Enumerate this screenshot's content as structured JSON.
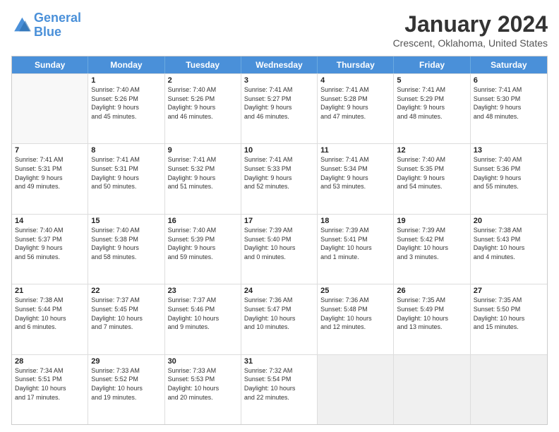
{
  "logo": {
    "text_general": "General",
    "text_blue": "Blue"
  },
  "title": "January 2024",
  "location": "Crescent, Oklahoma, United States",
  "days_header": [
    "Sunday",
    "Monday",
    "Tuesday",
    "Wednesday",
    "Thursday",
    "Friday",
    "Saturday"
  ],
  "weeks": [
    [
      {
        "day": "",
        "sunrise": "",
        "sunset": "",
        "daylight": "",
        "empty": true
      },
      {
        "day": "1",
        "sunrise": "Sunrise: 7:40 AM",
        "sunset": "Sunset: 5:26 PM",
        "daylight": "Daylight: 9 hours and 45 minutes."
      },
      {
        "day": "2",
        "sunrise": "Sunrise: 7:40 AM",
        "sunset": "Sunset: 5:26 PM",
        "daylight": "Daylight: 9 hours and 46 minutes."
      },
      {
        "day": "3",
        "sunrise": "Sunrise: 7:41 AM",
        "sunset": "Sunset: 5:27 PM",
        "daylight": "Daylight: 9 hours and 46 minutes."
      },
      {
        "day": "4",
        "sunrise": "Sunrise: 7:41 AM",
        "sunset": "Sunset: 5:28 PM",
        "daylight": "Daylight: 9 hours and 47 minutes."
      },
      {
        "day": "5",
        "sunrise": "Sunrise: 7:41 AM",
        "sunset": "Sunset: 5:29 PM",
        "daylight": "Daylight: 9 hours and 48 minutes."
      },
      {
        "day": "6",
        "sunrise": "Sunrise: 7:41 AM",
        "sunset": "Sunset: 5:30 PM",
        "daylight": "Daylight: 9 hours and 48 minutes."
      }
    ],
    [
      {
        "day": "7",
        "sunrise": "Sunrise: 7:41 AM",
        "sunset": "Sunset: 5:31 PM",
        "daylight": "Daylight: 9 hours and 49 minutes."
      },
      {
        "day": "8",
        "sunrise": "Sunrise: 7:41 AM",
        "sunset": "Sunset: 5:31 PM",
        "daylight": "Daylight: 9 hours and 50 minutes."
      },
      {
        "day": "9",
        "sunrise": "Sunrise: 7:41 AM",
        "sunset": "Sunset: 5:32 PM",
        "daylight": "Daylight: 9 hours and 51 minutes."
      },
      {
        "day": "10",
        "sunrise": "Sunrise: 7:41 AM",
        "sunset": "Sunset: 5:33 PM",
        "daylight": "Daylight: 9 hours and 52 minutes."
      },
      {
        "day": "11",
        "sunrise": "Sunrise: 7:41 AM",
        "sunset": "Sunset: 5:34 PM",
        "daylight": "Daylight: 9 hours and 53 minutes."
      },
      {
        "day": "12",
        "sunrise": "Sunrise: 7:40 AM",
        "sunset": "Sunset: 5:35 PM",
        "daylight": "Daylight: 9 hours and 54 minutes."
      },
      {
        "day": "13",
        "sunrise": "Sunrise: 7:40 AM",
        "sunset": "Sunset: 5:36 PM",
        "daylight": "Daylight: 9 hours and 55 minutes."
      }
    ],
    [
      {
        "day": "14",
        "sunrise": "Sunrise: 7:40 AM",
        "sunset": "Sunset: 5:37 PM",
        "daylight": "Daylight: 9 hours and 56 minutes."
      },
      {
        "day": "15",
        "sunrise": "Sunrise: 7:40 AM",
        "sunset": "Sunset: 5:38 PM",
        "daylight": "Daylight: 9 hours and 58 minutes."
      },
      {
        "day": "16",
        "sunrise": "Sunrise: 7:40 AM",
        "sunset": "Sunset: 5:39 PM",
        "daylight": "Daylight: 9 hours and 59 minutes."
      },
      {
        "day": "17",
        "sunrise": "Sunrise: 7:39 AM",
        "sunset": "Sunset: 5:40 PM",
        "daylight": "Daylight: 10 hours and 0 minutes."
      },
      {
        "day": "18",
        "sunrise": "Sunrise: 7:39 AM",
        "sunset": "Sunset: 5:41 PM",
        "daylight": "Daylight: 10 hours and 1 minute."
      },
      {
        "day": "19",
        "sunrise": "Sunrise: 7:39 AM",
        "sunset": "Sunset: 5:42 PM",
        "daylight": "Daylight: 10 hours and 3 minutes."
      },
      {
        "day": "20",
        "sunrise": "Sunrise: 7:38 AM",
        "sunset": "Sunset: 5:43 PM",
        "daylight": "Daylight: 10 hours and 4 minutes."
      }
    ],
    [
      {
        "day": "21",
        "sunrise": "Sunrise: 7:38 AM",
        "sunset": "Sunset: 5:44 PM",
        "daylight": "Daylight: 10 hours and 6 minutes."
      },
      {
        "day": "22",
        "sunrise": "Sunrise: 7:37 AM",
        "sunset": "Sunset: 5:45 PM",
        "daylight": "Daylight: 10 hours and 7 minutes."
      },
      {
        "day": "23",
        "sunrise": "Sunrise: 7:37 AM",
        "sunset": "Sunset: 5:46 PM",
        "daylight": "Daylight: 10 hours and 9 minutes."
      },
      {
        "day": "24",
        "sunrise": "Sunrise: 7:36 AM",
        "sunset": "Sunset: 5:47 PM",
        "daylight": "Daylight: 10 hours and 10 minutes."
      },
      {
        "day": "25",
        "sunrise": "Sunrise: 7:36 AM",
        "sunset": "Sunset: 5:48 PM",
        "daylight": "Daylight: 10 hours and 12 minutes."
      },
      {
        "day": "26",
        "sunrise": "Sunrise: 7:35 AM",
        "sunset": "Sunset: 5:49 PM",
        "daylight": "Daylight: 10 hours and 13 minutes."
      },
      {
        "day": "27",
        "sunrise": "Sunrise: 7:35 AM",
        "sunset": "Sunset: 5:50 PM",
        "daylight": "Daylight: 10 hours and 15 minutes."
      }
    ],
    [
      {
        "day": "28",
        "sunrise": "Sunrise: 7:34 AM",
        "sunset": "Sunset: 5:51 PM",
        "daylight": "Daylight: 10 hours and 17 minutes."
      },
      {
        "day": "29",
        "sunrise": "Sunrise: 7:33 AM",
        "sunset": "Sunset: 5:52 PM",
        "daylight": "Daylight: 10 hours and 19 minutes."
      },
      {
        "day": "30",
        "sunrise": "Sunrise: 7:33 AM",
        "sunset": "Sunset: 5:53 PM",
        "daylight": "Daylight: 10 hours and 20 minutes."
      },
      {
        "day": "31",
        "sunrise": "Sunrise: 7:32 AM",
        "sunset": "Sunset: 5:54 PM",
        "daylight": "Daylight: 10 hours and 22 minutes."
      },
      {
        "day": "",
        "sunrise": "",
        "sunset": "",
        "daylight": "",
        "empty": true
      },
      {
        "day": "",
        "sunrise": "",
        "sunset": "",
        "daylight": "",
        "empty": true
      },
      {
        "day": "",
        "sunrise": "",
        "sunset": "",
        "daylight": "",
        "empty": true
      }
    ]
  ]
}
